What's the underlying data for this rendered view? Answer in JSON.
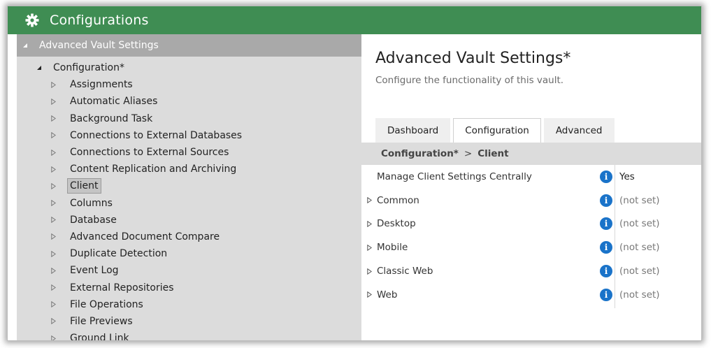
{
  "window": {
    "title": "Configurations",
    "icon": "gear-icon"
  },
  "tree": {
    "root_label": "Advanced Vault Settings",
    "config_label": "Configuration*",
    "selected": "Client",
    "items": [
      {
        "label": "Assignments"
      },
      {
        "label": "Automatic Aliases"
      },
      {
        "label": "Background Task"
      },
      {
        "label": "Connections to External Databases"
      },
      {
        "label": "Connections to External Sources"
      },
      {
        "label": "Content Replication and Archiving"
      },
      {
        "label": "Client"
      },
      {
        "label": "Columns"
      },
      {
        "label": "Database"
      },
      {
        "label": "Advanced Document Compare"
      },
      {
        "label": "Duplicate Detection"
      },
      {
        "label": "Event Log"
      },
      {
        "label": "External Repositories"
      },
      {
        "label": "File Operations"
      },
      {
        "label": "File Previews"
      },
      {
        "label": "Ground Link"
      }
    ]
  },
  "detail": {
    "title": "Advanced Vault Settings*",
    "subtitle": "Configure the functionality of this vault.",
    "tabs": [
      {
        "label": "Dashboard"
      },
      {
        "label": "Configuration"
      },
      {
        "label": "Advanced"
      }
    ],
    "active_tab": "Configuration",
    "breadcrumb": {
      "parent": "Configuration*",
      "separator": ">",
      "current": "Client"
    },
    "properties": [
      {
        "name": "Manage Client Settings Centrally",
        "value": "Yes",
        "expandable": false
      },
      {
        "name": "Common",
        "value": "(not set)",
        "expandable": true
      },
      {
        "name": "Desktop",
        "value": "(not set)",
        "expandable": true
      },
      {
        "name": "Mobile",
        "value": "(not set)",
        "expandable": true
      },
      {
        "name": "Classic Web",
        "value": "(not set)",
        "expandable": true
      },
      {
        "name": "Web",
        "value": "(not set)",
        "expandable": true
      }
    ]
  },
  "colors": {
    "titlebar": "#3f8d53",
    "tree_bg": "#dcdcdc",
    "root_bg": "#a9a9a9",
    "info_icon": "#1a73c9"
  }
}
